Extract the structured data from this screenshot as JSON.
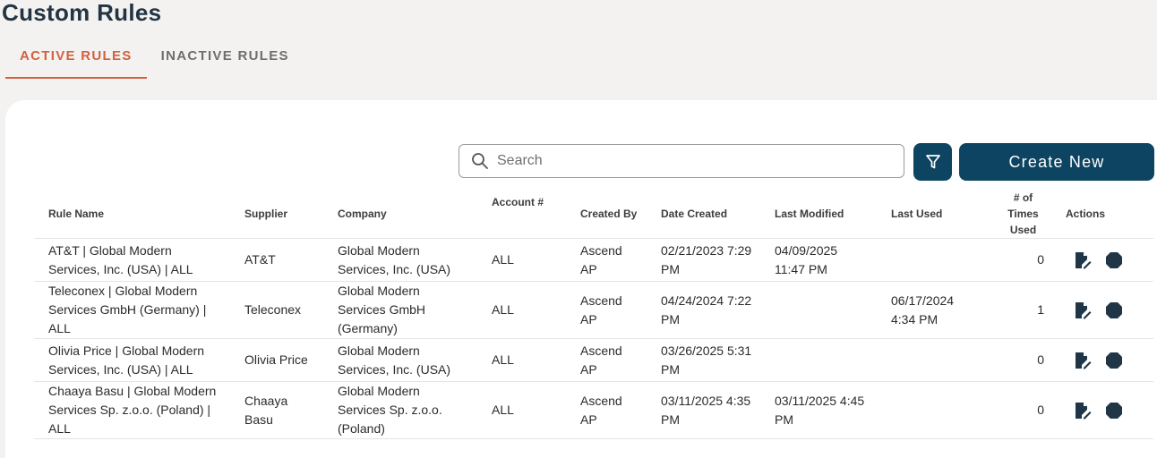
{
  "page": {
    "title": "Custom Rules"
  },
  "tabs": [
    {
      "label": "ACTIVE RULES",
      "active": true
    },
    {
      "label": "INACTIVE RULES",
      "active": false
    }
  ],
  "toolbar": {
    "search_placeholder": "Search",
    "create_label": "Create New",
    "search_icon": "search-icon",
    "filter_icon": "filter-icon"
  },
  "colors": {
    "accent": "#d3603f",
    "primary": "#0d4461",
    "background": "#f3f2f0"
  },
  "table": {
    "columns": {
      "rule_name": "Rule Name",
      "supplier": "Supplier",
      "company": "Company",
      "account": "Account #",
      "created_by": "Created By",
      "date_created": "Date Created",
      "last_modified": "Last Modified",
      "last_used": "Last Used",
      "times_used": "# of Times Used",
      "actions": "Actions"
    },
    "rows": [
      {
        "rule_name": "AT&T | Global Modern Services, Inc. (USA) | ALL",
        "supplier": "AT&T",
        "company": "Global Modern Services, Inc. (USA)",
        "account": "ALL",
        "created_by": "Ascend AP",
        "date_created": "02/21/2023 7:29 PM",
        "last_modified": "04/09/2025 11:47 PM",
        "last_used": "",
        "times_used": "0"
      },
      {
        "rule_name": "Teleconex | Global Modern Services GmbH (Germany) | ALL",
        "supplier": "Teleconex",
        "company": "Global Modern Services GmbH (Germany)",
        "account": "ALL",
        "created_by": "Ascend AP",
        "date_created": "04/24/2024 7:22 PM",
        "last_modified": "",
        "last_used": "06/17/2024 4:34 PM",
        "times_used": "1"
      },
      {
        "rule_name": "Olivia Price | Global Modern Services, Inc. (USA) | ALL",
        "supplier": "Olivia Price",
        "company": "Global Modern Services, Inc. (USA)",
        "account": "ALL",
        "created_by": "Ascend AP",
        "date_created": "03/26/2025 5:31 PM",
        "last_modified": "",
        "last_used": "",
        "times_used": "0"
      },
      {
        "rule_name": "Chaaya Basu | Global Modern Services Sp. z.o.o. (Poland) | ALL",
        "supplier": "Chaaya Basu",
        "company": "Global Modern Services Sp. z.o.o. (Poland)",
        "account": "ALL",
        "created_by": "Ascend AP",
        "date_created": "03/11/2025 4:35 PM",
        "last_modified": "03/11/2025 4:45 PM",
        "last_used": "",
        "times_used": "0"
      }
    ],
    "action_icons": [
      "edit-icon",
      "deactivate-icon"
    ]
  }
}
